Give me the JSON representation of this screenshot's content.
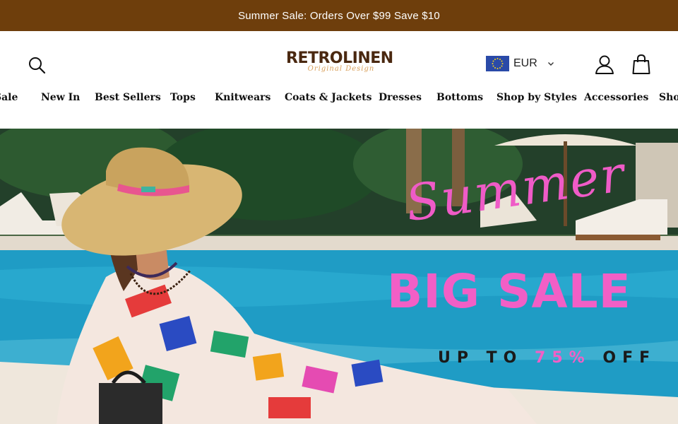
{
  "announcement": {
    "text": "Summer Sale: Orders Over $99 Save $10"
  },
  "header": {
    "logo_main": "RETROLINEN",
    "logo_sub": "Original Design",
    "currency": "EUR",
    "icons": {
      "search": "search-icon",
      "account": "user-icon",
      "cart": "shopping-bag-icon",
      "currency_flag": "eu-flag-icon",
      "dropdown": "chevron-down-icon"
    }
  },
  "nav": {
    "items": [
      {
        "label": "Sale"
      },
      {
        "label": "New In"
      },
      {
        "label": "Best Sellers"
      },
      {
        "label": "Tops"
      },
      {
        "label": "Knitwears"
      },
      {
        "label": "Coats & Jackets"
      },
      {
        "label": "Dresses"
      },
      {
        "label": "Bottoms"
      },
      {
        "label": "Shop by Styles"
      },
      {
        "label": "Accessories"
      },
      {
        "label": "Shop"
      }
    ]
  },
  "hero": {
    "script_text": "Summer",
    "headline": "BIG SALE",
    "offer_prefix": "UP TO",
    "offer_percent": "75%",
    "offer_suffix": "OFF"
  },
  "colors": {
    "announcement_bg": "#6e3e0c",
    "accent_pink": "#f25fc6",
    "logo_brown": "#4a2810"
  }
}
